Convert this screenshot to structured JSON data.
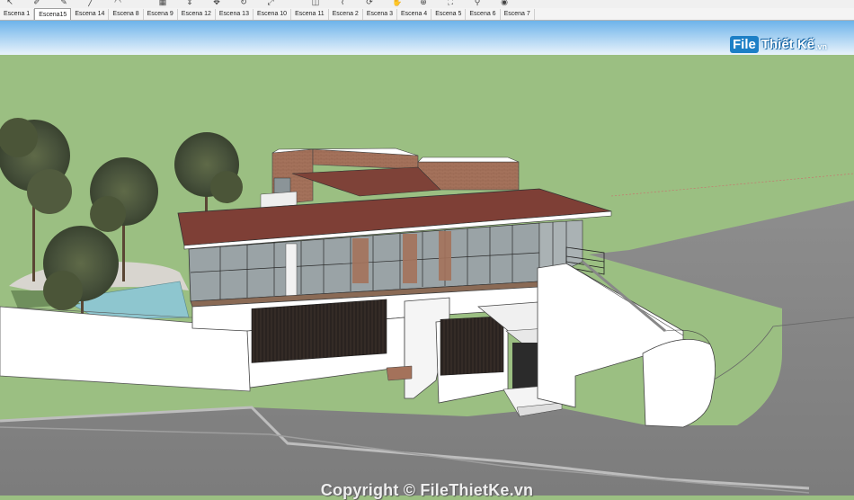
{
  "scene_tabs": [
    {
      "label": "Escena 1",
      "active": false
    },
    {
      "label": "Escena15",
      "active": true
    },
    {
      "label": "Escena 14",
      "active": false
    },
    {
      "label": "Escena 8",
      "active": false
    },
    {
      "label": "Escena 9",
      "active": false
    },
    {
      "label": "Escena 12",
      "active": false
    },
    {
      "label": "Escena 13",
      "active": false
    },
    {
      "label": "Escena 10",
      "active": false
    },
    {
      "label": "Escena 11",
      "active": false
    },
    {
      "label": "Escena 2",
      "active": false
    },
    {
      "label": "Escena 3",
      "active": false
    },
    {
      "label": "Escena 4",
      "active": false
    },
    {
      "label": "Escena 5",
      "active": false
    },
    {
      "label": "Escena 6",
      "active": false
    },
    {
      "label": "Escena 7",
      "active": false
    }
  ],
  "toolbar_icons": [
    "pointer-icon",
    "eraser-icon",
    "pencil-icon",
    "line-icon",
    "arc-icon",
    "paint-icon",
    "push-pull-icon",
    "move-icon",
    "rotate-icon",
    "scale-icon",
    "offset-icon",
    "tape-icon",
    "orbit-icon",
    "pan-icon",
    "zoom-icon",
    "zoom-extents-icon",
    "walk-icon",
    "look-icon"
  ],
  "watermark": {
    "logo_file": "File",
    "logo_rest": "Thiết Kế",
    "logo_tld": ".vn",
    "copyright": "Copyright © FileThietKe.vn"
  },
  "colors": {
    "sky_top": "#6fb4ea",
    "ground": "#9bbf82",
    "road": "#8a8a8a",
    "roof": "#8a4a40",
    "wall": "#ffffff",
    "glass": "#9aa3a6",
    "brick": "#a0705a",
    "pool": "#8ec6cf"
  }
}
